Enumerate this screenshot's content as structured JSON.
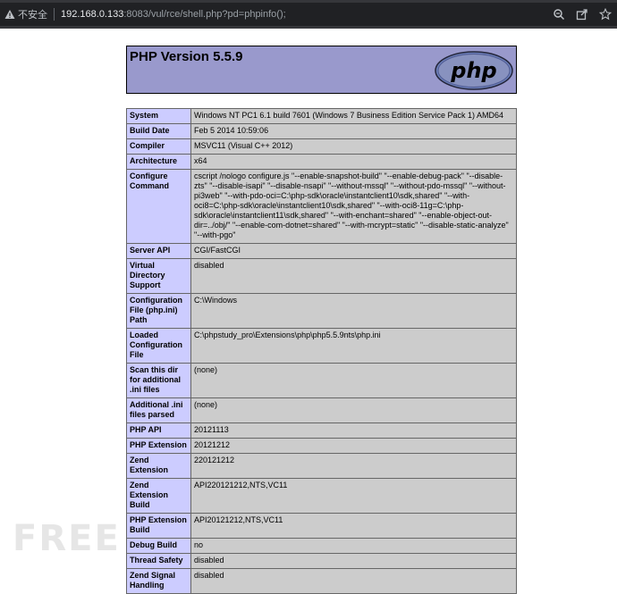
{
  "browser": {
    "security_label": "不安全",
    "url_host": "192.168.0.133",
    "url_rest": ":8083/vul/rce/shell.php?pd=phpinfo();"
  },
  "header": {
    "title": "PHP Version 5.5.9",
    "logo_text": "php"
  },
  "rows": [
    {
      "label": "System",
      "value": "Windows NT PC1 6.1 build 7601 (Windows 7 Business Edition Service Pack 1) AMD64"
    },
    {
      "label": "Build Date",
      "value": "Feb 5 2014 10:59:06"
    },
    {
      "label": "Compiler",
      "value": "MSVC11 (Visual C++ 2012)"
    },
    {
      "label": "Architecture",
      "value": "x64"
    },
    {
      "label": "Configure Command",
      "value": "cscript /nologo configure.js \"--enable-snapshot-build\" \"--enable-debug-pack\" \"--disable-zts\" \"--disable-isapi\" \"--disable-nsapi\" \"--without-mssql\" \"--without-pdo-mssql\" \"--without-pi3web\" \"--with-pdo-oci=C:\\php-sdk\\oracle\\instantclient10\\sdk,shared\" \"--with-oci8=C:\\php-sdk\\oracle\\instantclient10\\sdk,shared\" \"--with-oci8-11g=C:\\php-sdk\\oracle\\instantclient11\\sdk,shared\" \"--with-enchant=shared\" \"--enable-object-out-dir=../obj/\" \"--enable-com-dotnet=shared\" \"--with-mcrypt=static\" \"--disable-static-analyze\" \"--with-pgo\""
    },
    {
      "label": "Server API",
      "value": "CGI/FastCGI"
    },
    {
      "label": "Virtual Directory Support",
      "value": "disabled"
    },
    {
      "label": "Configuration File (php.ini) Path",
      "value": "C:\\Windows"
    },
    {
      "label": "Loaded Configuration File",
      "value": "C:\\phpstudy_pro\\Extensions\\php\\php5.5.9nts\\php.ini"
    },
    {
      "label": "Scan this dir for additional .ini files",
      "value": "(none)"
    },
    {
      "label": "Additional .ini files parsed",
      "value": "(none)"
    },
    {
      "label": "PHP API",
      "value": "20121113"
    },
    {
      "label": "PHP Extension",
      "value": "20121212"
    },
    {
      "label": "Zend Extension",
      "value": "220121212"
    },
    {
      "label": "Zend Extension Build",
      "value": "API220121212,NTS,VC11"
    },
    {
      "label": "PHP Extension Build",
      "value": "API20121212,NTS,VC11"
    },
    {
      "label": "Debug Build",
      "value": "no"
    },
    {
      "label": "Thread Safety",
      "value": "disabled"
    },
    {
      "label": "Zend Signal Handling",
      "value": "disabled"
    }
  ],
  "icons": {
    "warning": "warning-icon",
    "zoom": "zoom-icon",
    "share": "share-icon",
    "bookmark": "star-icon"
  },
  "colors": {
    "header_bg": "#9999cc",
    "label_bg": "#ccccff",
    "value_bg": "#cccccc"
  }
}
